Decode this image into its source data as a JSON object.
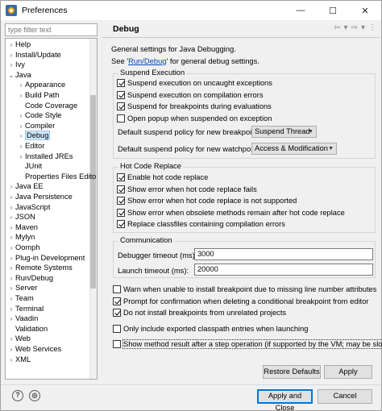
{
  "window": {
    "title": "Preferences",
    "minimize": "—",
    "maximize": "☐",
    "close": "✕"
  },
  "filter": {
    "placeholder": "type filter text"
  },
  "tree": [
    {
      "label": "Help",
      "indent": 0,
      "twisty": "›"
    },
    {
      "label": "Install/Update",
      "indent": 0,
      "twisty": "›"
    },
    {
      "label": "Ivy",
      "indent": 0,
      "twisty": "›"
    },
    {
      "label": "Java",
      "indent": 0,
      "twisty": "⌄"
    },
    {
      "label": "Appearance",
      "indent": 1,
      "twisty": "›"
    },
    {
      "label": "Build Path",
      "indent": 1,
      "twisty": "›"
    },
    {
      "label": "Code Coverage",
      "indent": 1,
      "twisty": ""
    },
    {
      "label": "Code Style",
      "indent": 1,
      "twisty": "›"
    },
    {
      "label": "Compiler",
      "indent": 1,
      "twisty": "›"
    },
    {
      "label": "Debug",
      "indent": 1,
      "twisty": "›",
      "selected": true
    },
    {
      "label": "Editor",
      "indent": 1,
      "twisty": "›"
    },
    {
      "label": "Installed JREs",
      "indent": 1,
      "twisty": "›"
    },
    {
      "label": "JUnit",
      "indent": 1,
      "twisty": ""
    },
    {
      "label": "Properties Files Edito",
      "indent": 1,
      "twisty": ""
    },
    {
      "label": "Java EE",
      "indent": 0,
      "twisty": "›"
    },
    {
      "label": "Java Persistence",
      "indent": 0,
      "twisty": "›"
    },
    {
      "label": "JavaScript",
      "indent": 0,
      "twisty": "›"
    },
    {
      "label": "JSON",
      "indent": 0,
      "twisty": "›"
    },
    {
      "label": "Maven",
      "indent": 0,
      "twisty": "›"
    },
    {
      "label": "Mylyn",
      "indent": 0,
      "twisty": "›"
    },
    {
      "label": "Oomph",
      "indent": 0,
      "twisty": "›"
    },
    {
      "label": "Plug-in Development",
      "indent": 0,
      "twisty": "›"
    },
    {
      "label": "Remote Systems",
      "indent": 0,
      "twisty": "›"
    },
    {
      "label": "Run/Debug",
      "indent": 0,
      "twisty": "›"
    },
    {
      "label": "Server",
      "indent": 0,
      "twisty": "›"
    },
    {
      "label": "Team",
      "indent": 0,
      "twisty": "›"
    },
    {
      "label": "Terminal",
      "indent": 0,
      "twisty": "›"
    },
    {
      "label": "Vaadin",
      "indent": 0,
      "twisty": "›"
    },
    {
      "label": "Validation",
      "indent": 0,
      "twisty": ""
    },
    {
      "label": "Web",
      "indent": 0,
      "twisty": "›"
    },
    {
      "label": "Web Services",
      "indent": 0,
      "twisty": "›"
    },
    {
      "label": "XML",
      "indent": 0,
      "twisty": "›"
    }
  ],
  "page": {
    "title": "Debug",
    "nav": {
      "back": "⇦",
      "back_menu": "▾",
      "forward": "⇨",
      "forward_menu": "▾",
      "more": "⋮"
    },
    "intro": "General settings for Java Debugging.",
    "see_prefix": "See '",
    "see_link": "Run/Debug",
    "see_suffix": "' for general debug settings.",
    "suspend": {
      "title": "Suspend Execution",
      "options": [
        {
          "label": "Suspend execution on uncaught exceptions",
          "checked": true
        },
        {
          "label": "Suspend execution on compilation errors",
          "checked": true
        },
        {
          "label": "Suspend for breakpoints during evaluations",
          "checked": true
        },
        {
          "label": "Open popup when suspended on exception",
          "checked": false
        }
      ],
      "breakpoints_label": "Default suspend policy for new breakpoints:",
      "breakpoints_value": "Suspend Thread",
      "watchpoints_label": "Default suspend policy for new watchpoints:",
      "watchpoints_value": "Access & Modification"
    },
    "hcr": {
      "title": "Hot Code Replace",
      "options": [
        {
          "label": "Enable hot code replace",
          "checked": true
        },
        {
          "label": "Show error when hot code replace fails",
          "checked": true
        },
        {
          "label": "Show error when hot code replace is not supported",
          "checked": true
        },
        {
          "label": "Show error when obsolete methods remain after hot code replace",
          "checked": true
        },
        {
          "label": "Replace classfiles containing compilation errors",
          "checked": true
        }
      ]
    },
    "comm": {
      "title": "Communication",
      "debugger_label": "Debugger timeout (ms):",
      "debugger_value": "3000",
      "launch_label": "Launch timeout (ms):",
      "launch_value": "20000"
    },
    "misc": [
      {
        "label": "Warn when unable to install breakpoint due to missing line number attributes",
        "checked": false
      },
      {
        "label": "Prompt for confirmation when deleting a conditional breakpoint from editor",
        "checked": true
      },
      {
        "label": "Do not install breakpoints from unrelated projects",
        "checked": true
      },
      {
        "label": "Only include exported classpath entries when launching",
        "checked": false
      },
      {
        "label": "Show method result after a step operation (if supported by the VM; may be slow)",
        "checked": false
      }
    ],
    "restore_label": "Restore Defaults",
    "apply_label": "Apply"
  },
  "footer": {
    "help_icon": "?",
    "import_icon": "◎",
    "apply_close_label": "Apply and Close",
    "cancel_label": "Cancel"
  }
}
